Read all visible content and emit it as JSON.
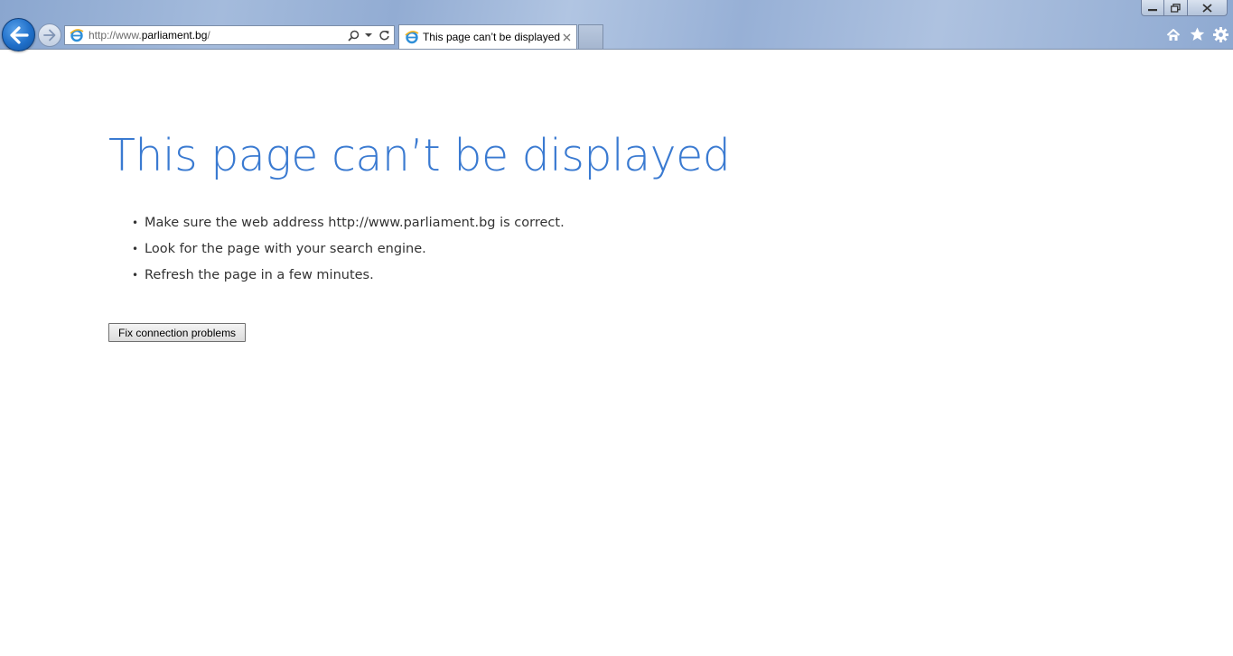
{
  "browser": {
    "address_prefix": "http://www.",
    "address_host": "parliament.bg",
    "address_suffix": "/",
    "tab_title": "This page can’t be displayed",
    "accent_color": "#3a7ad1"
  },
  "page": {
    "title": "This page can’t be displayed",
    "tips": [
      "Make sure the web address http://www.parliament.bg is correct.",
      "Look for the page with your search engine.",
      "Refresh the page in a few minutes."
    ],
    "fix_button_label": "Fix connection problems"
  }
}
